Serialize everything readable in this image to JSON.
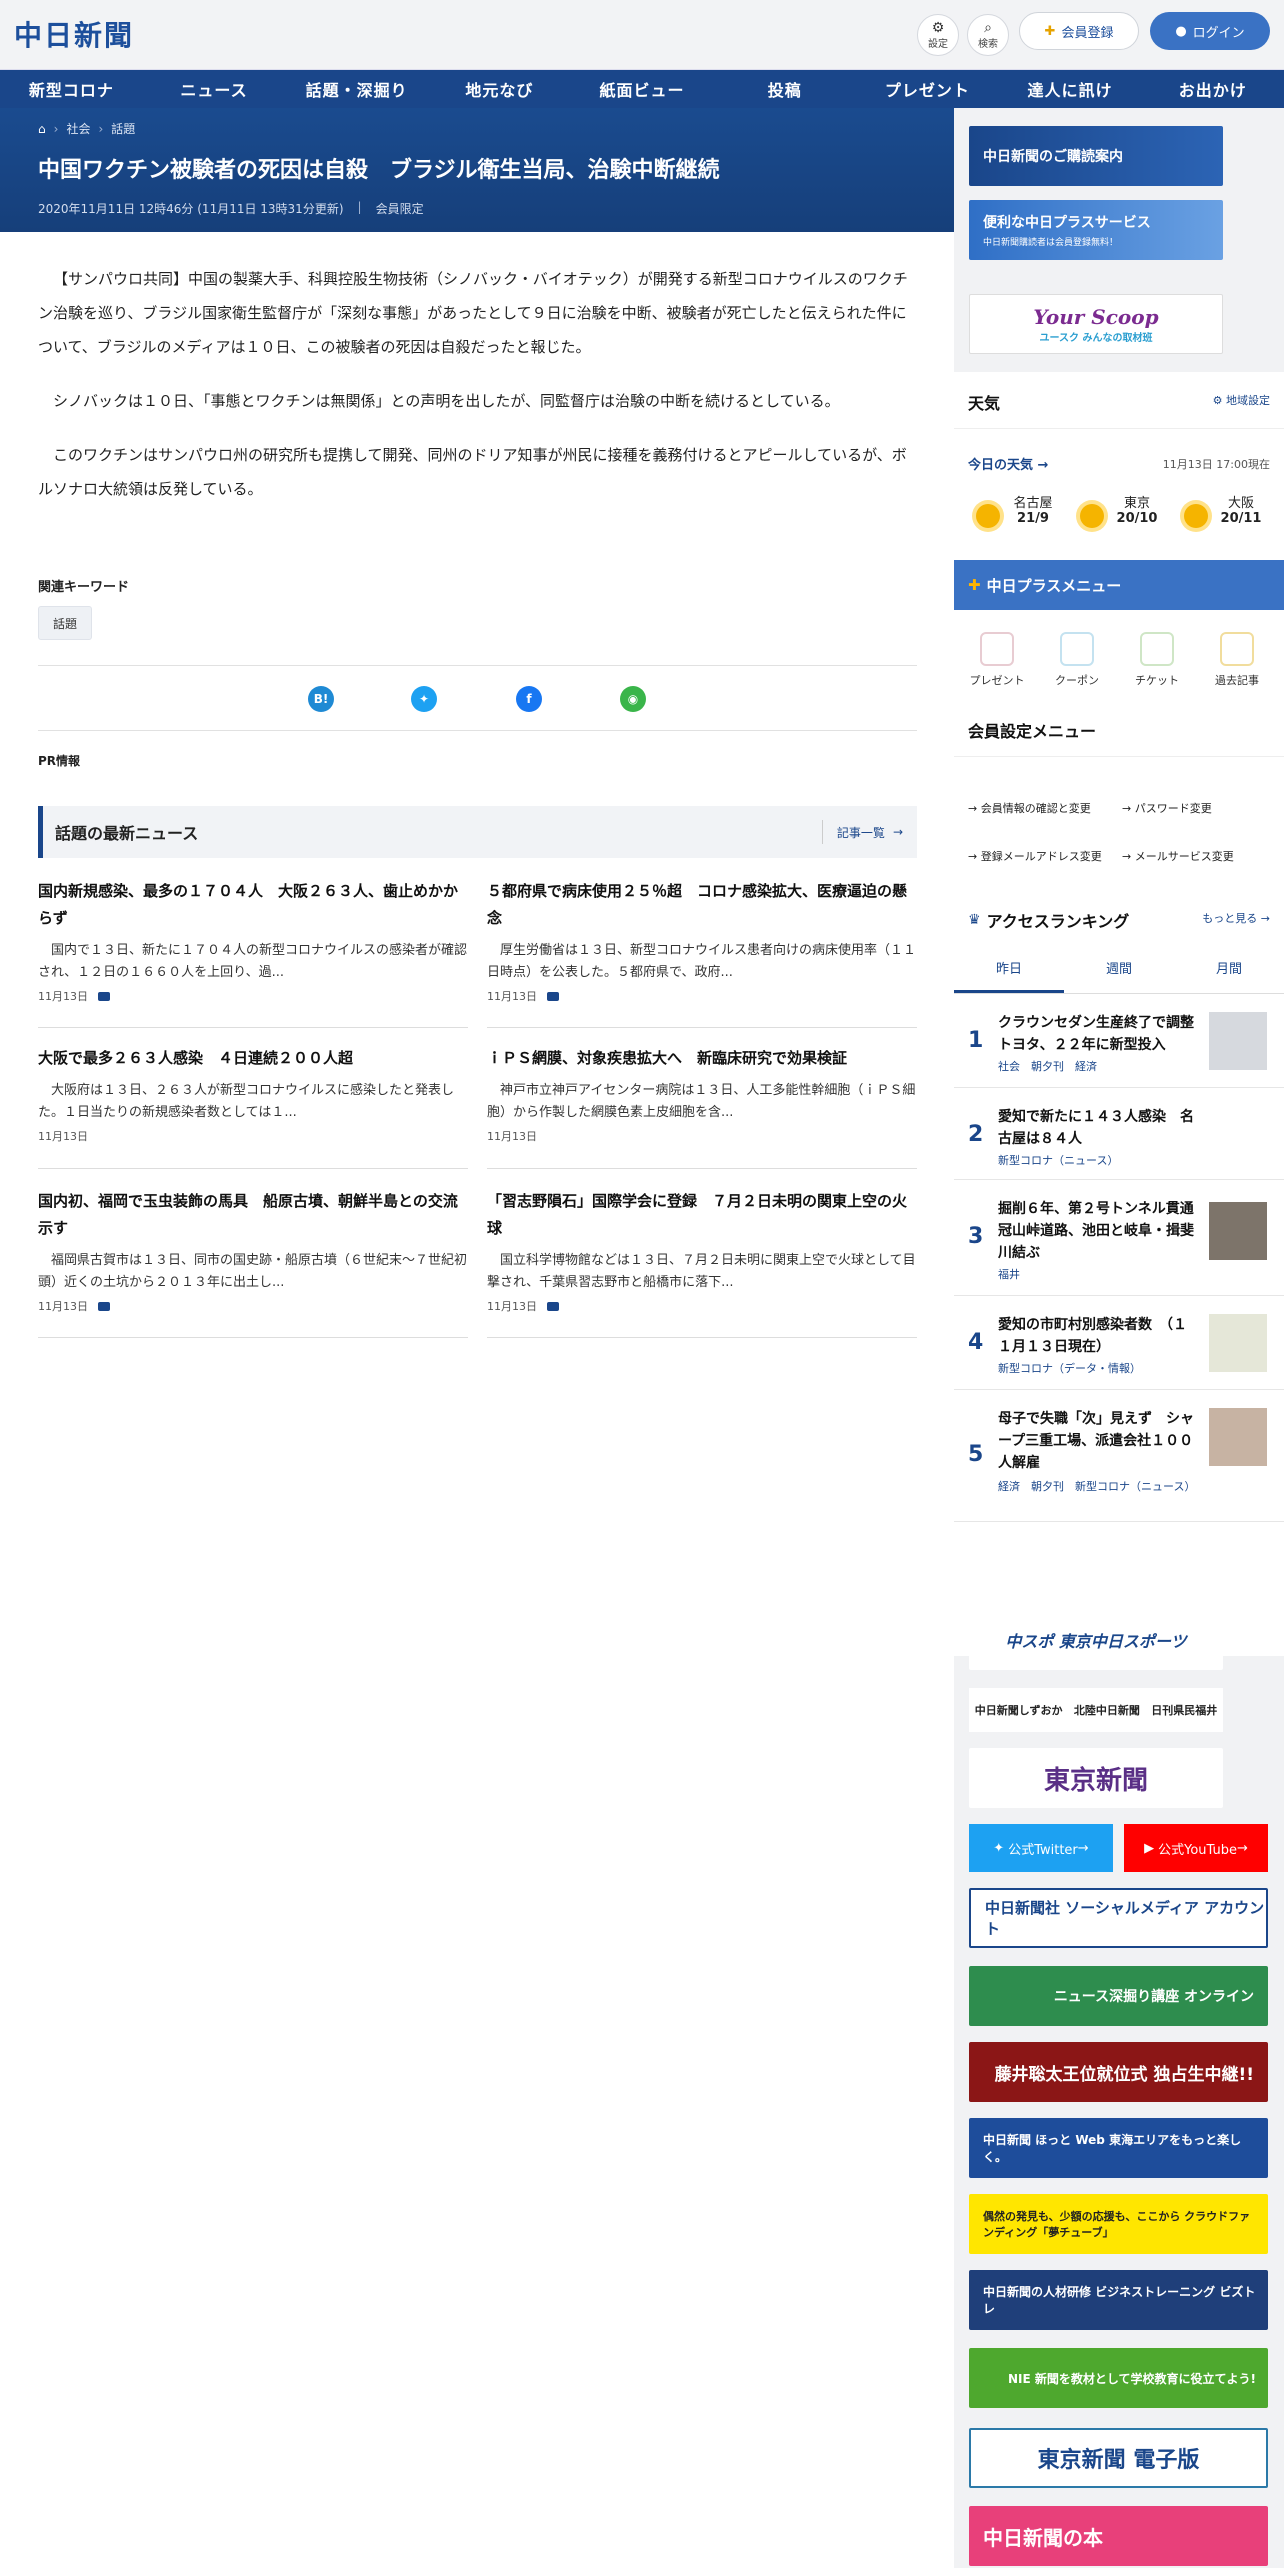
{
  "header": {
    "logo": "中日新聞",
    "settings_label": "設定",
    "search_label": "検索",
    "member_label": "会員登録",
    "login_label": "ログイン"
  },
  "nav": [
    "新型コロナ",
    "ニュース",
    "話題・深掘り",
    "地元なび",
    "紙面ビュー",
    "投稿",
    "プレゼント",
    "達人に訊け",
    "お出かけ"
  ],
  "article": {
    "crumbs": [
      "社会",
      "話題"
    ],
    "title": "中国ワクチン被験者の死因は自殺　ブラジル衛生当局、治験中断継続",
    "date": "2020年11月11日 12時46分 (11月11日 13時31分更新)",
    "members": "会員限定",
    "paragraphs": [
      "【サンパウロ共同】中国の製薬大手、科興控股生物技術（シノバック・バイオテック）が開発する新型コロナウイルスのワクチン治験を巡り、ブラジル国家衛生監督庁が「深刻な事態」があったとして９日に治験を中断、被験者が死亡したと伝えられた件について、ブラジルのメディアは１０日、この被験者の死因は自殺だったと報じた。",
      "シノバックは１０日、「事態とワクチンは無関係」との声明を出したが、同監督庁は治験の中断を続けるとしている。",
      "このワクチンはサンパウロ州の研究所も提携して開発、同州のドリア知事が州民に接種を義務付けるとアピールしているが、ボルソナロ大統領は反発している。"
    ],
    "keyword_label": "関連キーワード",
    "keyword": "話題",
    "pr_label": "PR情報"
  },
  "latest": {
    "title": "話題の最新ニュース",
    "more": "記事一覧",
    "items": [
      {
        "title": "国内新規感染、最多の１７０４人　大阪２６３人、歯止めかからず",
        "excerpt": "国内で１３日、新たに１７０４人の新型コロナウイルスの感染者が確認され、１２日の１６６０人を上回り、過...",
        "date": "11月13日",
        "photo": true
      },
      {
        "title": "５都府県で病床使用２５％超　コロナ感染拡大、医療逼迫の懸念",
        "excerpt": "厚生労働省は１３日、新型コロナウイルス患者向けの病床使用率（１１日時点）を公表した。５都府県で、政府...",
        "date": "11月13日",
        "photo": true
      },
      {
        "title": "大阪で最多２６３人感染　４日連続２００人超",
        "excerpt": "大阪府は１３日、２６３人が新型コロナウイルスに感染したと発表した。１日当たりの新規感染者数としては１...",
        "date": "11月13日",
        "photo": false
      },
      {
        "title": "ｉＰＳ網膜、対象疾患拡大へ　新臨床研究で効果検証",
        "excerpt": "神戸市立神戸アイセンター病院は１３日、人工多能性幹細胞（ｉＰＳ細胞）から作製した網膜色素上皮細胞を含...",
        "date": "11月13日",
        "photo": false
      },
      {
        "title": "国内初、福岡で玉虫装飾の馬具　船原古墳、朝鮮半島との交流示す",
        "excerpt": "福岡県古賀市は１３日、同市の国史跡・船原古墳（６世紀末～７世紀初頭）近くの土坑から２０１３年に出土し...",
        "date": "11月13日",
        "photo": true
      },
      {
        "title": "「習志野隕石」国際学会に登録　７月２日未明の関東上空の火球",
        "excerpt": "国立科学博物館などは１３日、７月２日未明に関東上空で火球として目撃され、千葉県習志野市と船橋市に落下...",
        "date": "11月13日",
        "photo": true
      }
    ]
  },
  "sidebar": {
    "banner1": "中日新聞のご購読案内",
    "banner2": "便利な中日プラスサービス",
    "banner2_sub": "中日新聞購読者は会員登録無料！",
    "banner3": "Your Scoop",
    "banner3_sub": "ユースク みんなの取材班",
    "weather_title": "天気",
    "weather_setting": "地域設定",
    "weather_today": "今日の天気",
    "weather_time": "11月13日 17:00現在",
    "weather": [
      {
        "city": "名古屋",
        "temp": "21/9"
      },
      {
        "city": "東京",
        "temp": "20/10"
      },
      {
        "city": "大阪",
        "temp": "20/11"
      }
    ],
    "plus_menu_title": "中日プラスメニュー",
    "plus_menu": [
      "プレゼント",
      "クーポン",
      "チケット",
      "過去記事"
    ],
    "member_menu_title": "会員設定メニュー",
    "member_menu": [
      "会員情報の確認と変更",
      "パスワード変更",
      "登録メールアドレス変更",
      "メールサービス変更"
    ],
    "ranking_title": "アクセスランキング",
    "ranking_more": "もっと見る",
    "ranking_tabs": [
      "昨日",
      "週間",
      "月間"
    ],
    "ranking": [
      {
        "num": "1",
        "title": "クラウンセダン生産終了で調整　トヨタ、２２年に新型投入",
        "tags": "社会　朝夕刊　経済"
      },
      {
        "num": "2",
        "title": "愛知で新たに１４３人感染　名古屋は８４人",
        "tags": "新型コロナ（ニュース）"
      },
      {
        "num": "3",
        "title": "掘削６年、第２号トンネル貫通　冠山峠道路、池田と岐阜・揖斐川結ぶ",
        "tags": "福井"
      },
      {
        "num": "4",
        "title": "愛知の市町村別感染者数　（１１月１３日現在）",
        "tags": "新型コロナ（データ・情報）"
      },
      {
        "num": "5",
        "title": "母子で失職「次」見えず　シャープ三重工場、派遣会社１００人解雇",
        "tags": "経済　朝夕刊　新型コロナ（ニュース）"
      }
    ],
    "chuspo": "中スポ 東京中日スポーツ",
    "papers": [
      "中日新聞しずおか",
      "北陸中日新聞",
      "日刊県民福井"
    ],
    "tokyo": "東京新聞",
    "twitter": "公式Twitter",
    "youtube": "公式YouTube",
    "social": "中日新聞社 ソーシャルメディア アカウント",
    "ads": [
      "ニュース深掘り講座 オンライン",
      "藤井聡太王位就位式 独占生中継!!",
      "中日新聞 ほっと Web 東海エリアをもっと楽しく。",
      "偶然の発見も、少額の応援も、ここから クラウドファンディング「夢チューブ」",
      "中日新聞の人材研修 ビジネストレーニング ビズトレ",
      "NIE 新聞を教材として学校教育に役立てよう!",
      "東京新聞 電子版",
      "中日新聞の本"
    ]
  },
  "colors": {
    "brand": "#1a468a",
    "login": "#3a72c4",
    "twitter": "#1da1f2",
    "youtube": "#ff0000"
  }
}
